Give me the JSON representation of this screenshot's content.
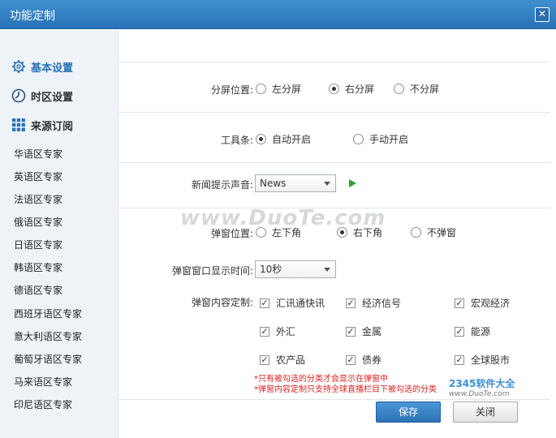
{
  "window": {
    "title": "功能定制"
  },
  "sidebar": {
    "headers": [
      {
        "label": "基本设置",
        "icon": "gear-icon"
      },
      {
        "label": "时区设置",
        "icon": "clock-icon"
      },
      {
        "label": "来源订阅",
        "icon": "grid-icon"
      }
    ],
    "items": [
      "华语区专家",
      "英语区专家",
      "法语区专家",
      "俄语区专家",
      "日语区专家",
      "韩语区专家",
      "德语区专家",
      "西班牙语区专家",
      "意大利语区专家",
      "葡萄牙语区专家",
      "马来语区专家",
      "印尼语区专家"
    ]
  },
  "settings": {
    "split": {
      "label": "分屏位置:",
      "options": [
        "左分屏",
        "右分屏",
        "不分屏"
      ],
      "selected": 1
    },
    "toolbar": {
      "label": "工具条:",
      "options": [
        "自动开启",
        "手动开启"
      ],
      "selected": 0
    },
    "sound": {
      "label": "新闻提示声音:",
      "value": "News"
    },
    "popup_pos": {
      "label": "弹窗位置:",
      "options": [
        "左下角",
        "右下角",
        "不弹窗"
      ],
      "selected": 1
    },
    "popup_time": {
      "label": "弹窗窗口显示时间:",
      "value": "10秒"
    },
    "popup_content": {
      "label": "弹窗内容定制:",
      "checks": [
        "汇讯通快讯",
        "经济信号",
        "宏观经济",
        "外汇",
        "金属",
        "能源",
        "农产品",
        "债券",
        "全球股市"
      ]
    },
    "notes": [
      "*只有被勾选的分类才会显示在弹窗中",
      "*弹窗内容定制只支持全球直播栏目下被勾选的分类"
    ]
  },
  "buttons": {
    "save": "保存",
    "cancel": "关闭"
  },
  "watermarks": {
    "duote": "www.DuoTe.com",
    "brand": "2345软件大全",
    "brand_url": "www.DuoTe.com"
  },
  "colors": {
    "titlebar": "#2a72b8",
    "accent": "#2a72b8",
    "note": "#e02020",
    "play": "#2aa32a"
  }
}
